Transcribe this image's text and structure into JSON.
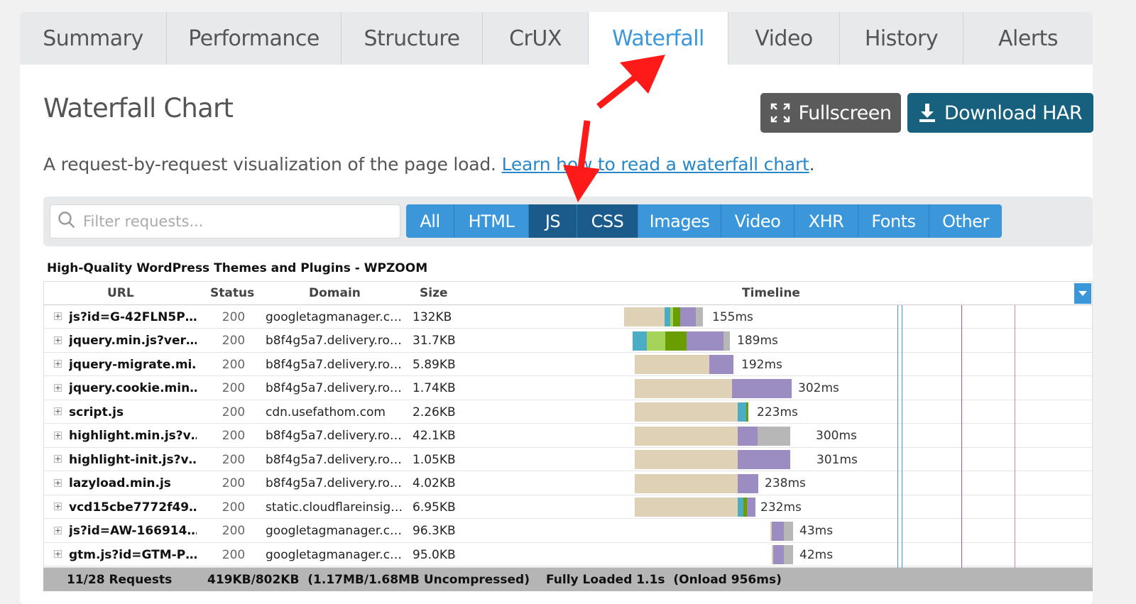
{
  "tabs": [
    {
      "label": "Summary",
      "active": false
    },
    {
      "label": "Performance",
      "active": false
    },
    {
      "label": "Structure",
      "active": false
    },
    {
      "label": "CrUX",
      "active": false
    },
    {
      "label": "Waterfall",
      "active": true
    },
    {
      "label": "Video",
      "active": false
    },
    {
      "label": "History",
      "active": false
    },
    {
      "label": "Alerts",
      "active": false
    }
  ],
  "header": {
    "title": "Waterfall Chart",
    "fullscreen_label": "Fullscreen",
    "download_label": "Download HAR",
    "description": "A request-by-request visualization of the page load. ",
    "learn_link": "Learn how to read a waterfall chart",
    "description_end": "."
  },
  "filter": {
    "placeholder": "Filter requests...",
    "types": [
      {
        "label": "All",
        "selected": false
      },
      {
        "label": "HTML",
        "selected": false
      },
      {
        "label": "JS",
        "selected": true
      },
      {
        "label": "CSS",
        "selected": true
      },
      {
        "label": "Images",
        "selected": false
      },
      {
        "label": "Video",
        "selected": false
      },
      {
        "label": "XHR",
        "selected": false
      },
      {
        "label": "Fonts",
        "selected": false
      },
      {
        "label": "Other",
        "selected": false
      }
    ]
  },
  "waterfall": {
    "page_title": "High-Quality WordPress Themes and Plugins - WPZOOM",
    "columns": {
      "url": "URL",
      "status": "Status",
      "domain": "Domain",
      "size": "Size",
      "timeline": "Timeline"
    },
    "rows": [
      {
        "url": "js?id=G-42FLN5P…",
        "status": "200",
        "domain": "googletagmanager.c…",
        "size": "132KB",
        "duration": "155ms"
      },
      {
        "url": "jquery.min.js?ver…",
        "status": "200",
        "domain": "b8f4g5a7.delivery.ro…",
        "size": "31.7KB",
        "duration": "189ms"
      },
      {
        "url": "jquery-migrate.mi…",
        "status": "200",
        "domain": "b8f4g5a7.delivery.ro…",
        "size": "5.89KB",
        "duration": "192ms"
      },
      {
        "url": "jquery.cookie.min…",
        "status": "200",
        "domain": "b8f4g5a7.delivery.ro…",
        "size": "1.74KB",
        "duration": "302ms"
      },
      {
        "url": "script.js",
        "status": "200",
        "domain": "cdn.usefathom.com",
        "size": "2.26KB",
        "duration": "223ms"
      },
      {
        "url": "highlight.min.js?v…",
        "status": "200",
        "domain": "b8f4g5a7.delivery.ro…",
        "size": "42.1KB",
        "duration": "300ms"
      },
      {
        "url": "highlight-init.js?v…",
        "status": "200",
        "domain": "b8f4g5a7.delivery.ro…",
        "size": "1.05KB",
        "duration": "301ms"
      },
      {
        "url": "lazyload.min.js",
        "status": "200",
        "domain": "b8f4g5a7.delivery.ro…",
        "size": "4.02KB",
        "duration": "238ms"
      },
      {
        "url": "vcd15cbe7772f49…",
        "status": "200",
        "domain": "static.cloudflareinsig…",
        "size": "6.95KB",
        "duration": "232ms"
      },
      {
        "url": "js?id=AW-166914…",
        "status": "200",
        "domain": "googletagmanager.c…",
        "size": "96.3KB",
        "duration": "43ms"
      },
      {
        "url": "gtm.js?id=GTM-P…",
        "status": "200",
        "domain": "googletagmanager.c…",
        "size": "95.0KB",
        "duration": "42ms"
      }
    ],
    "footer": {
      "requests": "11/28 Requests",
      "size": "419KB/802KB  (1.17MB/1.68MB Uncompressed)",
      "loaded": "Fully Loaded 1.1s  (Onload 956ms)"
    }
  },
  "colors": {
    "accent": "#3c97da",
    "selected_filter": "#1a5b8c",
    "download_button": "#17617e",
    "fullscreen_button": "#5b5b5b",
    "blocked": "#ded1b5",
    "dns": "#4bacc6",
    "connect": "#a6d35a",
    "ssl": "#6a9e00",
    "wait": "#9b8dc2",
    "receive": "#b7b7b7",
    "arrow": "#ff1a1a"
  }
}
